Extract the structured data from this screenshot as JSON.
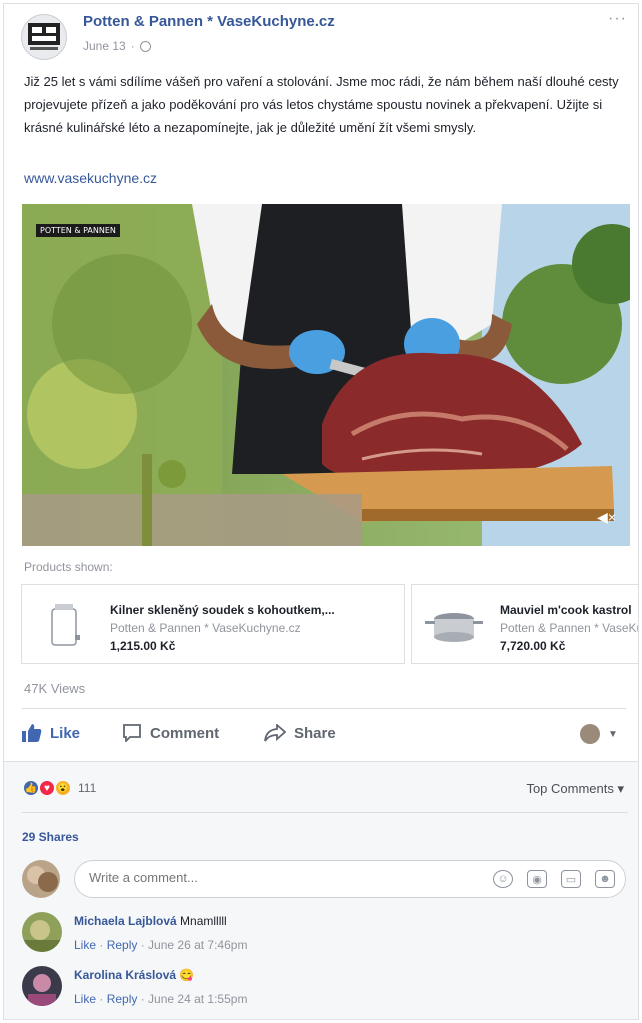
{
  "post": {
    "page_name": "Potten & Pannen * VaseKuchyne.cz",
    "date": "June 13",
    "dot": "·",
    "more": "···",
    "text": "Již 25 let s vámi sdílíme vášeň pro vaření a stolování. Jsme moc rádi, že nám během naší dlouhé cesty projevujete přízeň a jako poděkování pro vás letos chystáme spoustu novinek a překvapení. Užijte si krásné kulinářské léto a nezapomínejte, jak je důležité umění žít všemi smysly.",
    "link": "www.vasekuchyne.cz"
  },
  "video": {
    "badge": "POTTEN & PANNEN",
    "mute_icon": "speaker-muted-icon"
  },
  "products": {
    "label": "Products shown:",
    "items": [
      {
        "name": "Kilner skleněný soudek s kohoutkem,...",
        "seller": "Potten & Pannen * VaseKuchyne.cz",
        "price": "1,215.00 Kč"
      },
      {
        "name": "Mauviel m'cook kastrol",
        "seller": "Potten & Pannen * VaseKuchyne.cz",
        "price": "7,720.00 Kč"
      }
    ]
  },
  "stats": {
    "views": "47K Views"
  },
  "actions": {
    "like": "Like",
    "comment": "Comment",
    "share": "Share"
  },
  "reactions": {
    "count": "111",
    "colors": {
      "like": "#4267b2",
      "love": "#f0284a",
      "wow": "#f7b125"
    },
    "top_comments": "Top Comments ▾",
    "shares": "29 Shares"
  },
  "compose": {
    "placeholder": "Write a comment..."
  },
  "comments": [
    {
      "name": "Michaela Lajblová",
      "text": "Mnamlllll",
      "like": "Like",
      "reply": "Reply",
      "sep": " · ",
      "time": "June 26 at 7:46pm"
    },
    {
      "name": "Karolina Kráslová",
      "emoji": "😋",
      "like": "Like",
      "reply": "Reply",
      "sep": " · ",
      "time": "June 24 at 1:55pm"
    }
  ]
}
